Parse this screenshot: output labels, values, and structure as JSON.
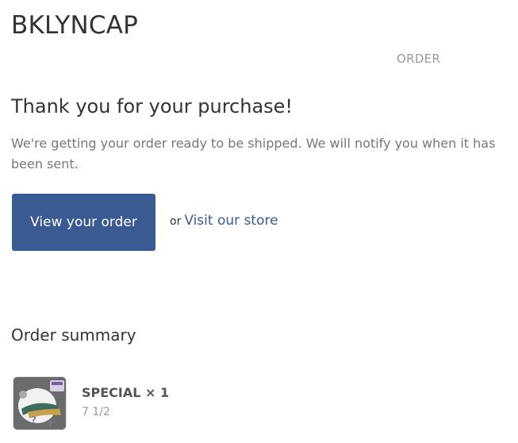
{
  "header": {
    "shop_name": "BKLYNCAP",
    "order_label": "ORDER"
  },
  "confirmation": {
    "heading": "Thank you for your purchase!",
    "message": "We're getting your order ready to be shipped. We will notify you when it has been sent.",
    "view_order_label": "View your order",
    "or_text": "or",
    "visit_store_label": "Visit our store",
    "button_color": "#3a5a92"
  },
  "order_summary": {
    "title": "Order summary",
    "items": [
      {
        "name": "SPECIAL × 1",
        "variant": "7 1/2",
        "image_icon": "cap-product-thumbnail"
      }
    ]
  }
}
